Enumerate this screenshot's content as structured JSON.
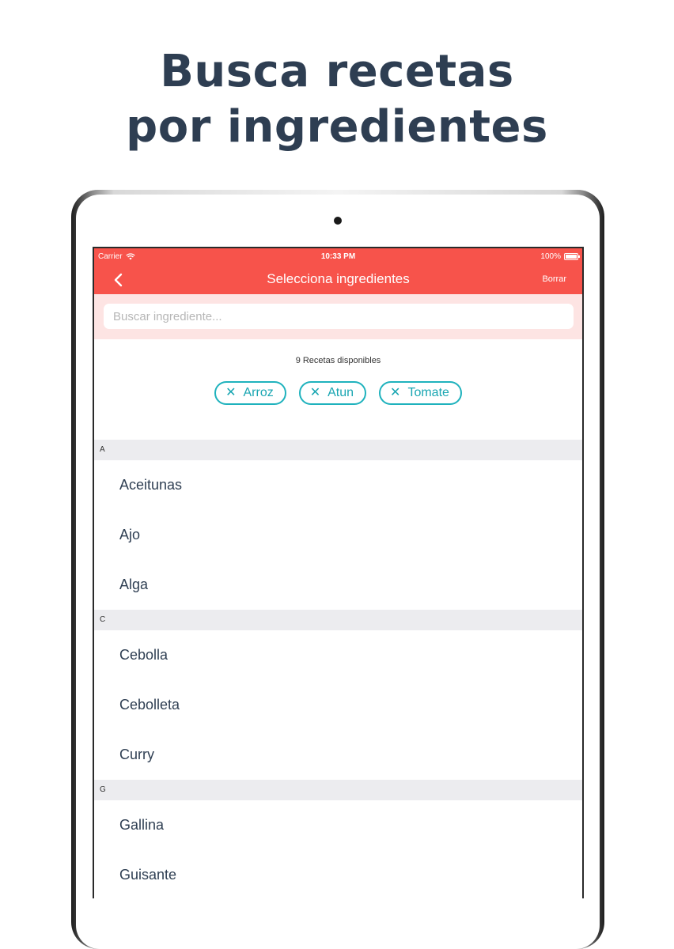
{
  "headline": {
    "line1": "Busca recetas",
    "line2": "por ingredientes"
  },
  "status": {
    "carrier": "Carrier",
    "time": "10:33 PM",
    "battery": "100%"
  },
  "navbar": {
    "title": "Selecciona ingredientes",
    "clear_label": "Borrar",
    "back_icon": "chevron-left-icon"
  },
  "search": {
    "placeholder": "Buscar ingrediente...",
    "value": ""
  },
  "recipes": {
    "count_label": "9 Recetas disponibles"
  },
  "chips": [
    {
      "label": "Arroz"
    },
    {
      "label": "Atun"
    },
    {
      "label": "Tomate"
    }
  ],
  "sections": [
    {
      "letter": "A",
      "items": [
        "Aceitunas",
        "Ajo",
        "Alga"
      ]
    },
    {
      "letter": "C",
      "items": [
        "Cebolla",
        "Cebolleta",
        "Curry"
      ]
    },
    {
      "letter": "G",
      "items": [
        "Gallina",
        "Guisante"
      ]
    }
  ],
  "colors": {
    "accent": "#f7534b",
    "chip": "#1fb2bd",
    "heading": "#2e3e52",
    "search_bg": "#fde4e3"
  }
}
